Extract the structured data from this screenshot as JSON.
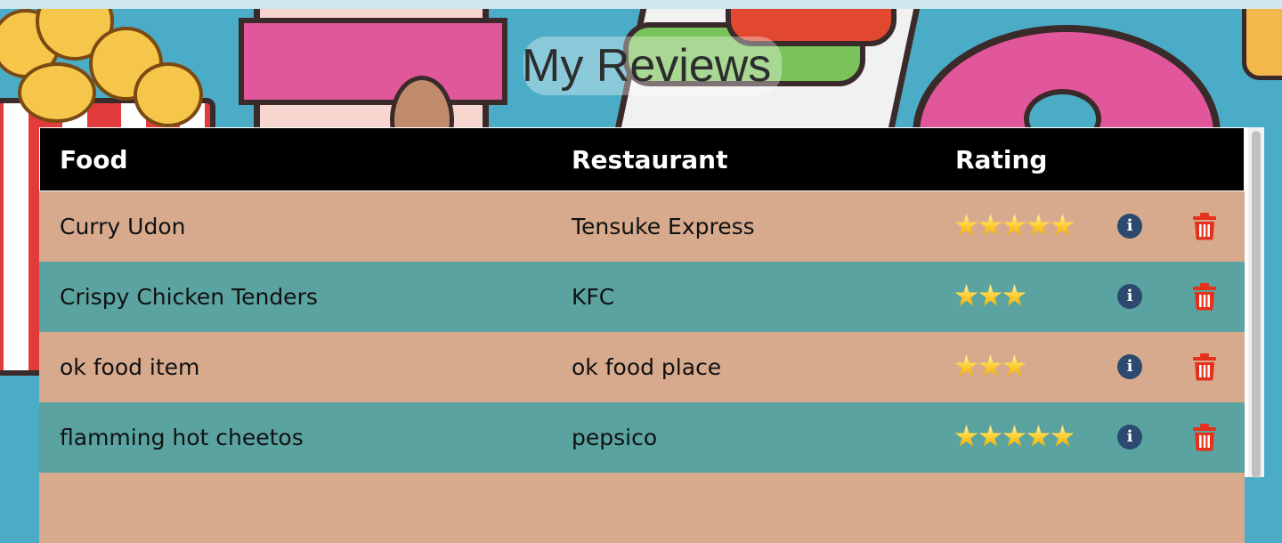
{
  "page": {
    "title": "My Reviews"
  },
  "table": {
    "headers": {
      "food": "Food",
      "restaurant": "Restaurant",
      "rating": "Rating"
    },
    "rows": [
      {
        "food": "Curry Udon",
        "restaurant": "Tensuke Express",
        "rating": 5
      },
      {
        "food": "Crispy Chicken Tenders",
        "restaurant": "KFC",
        "rating": 3
      },
      {
        "food": "ok food item",
        "restaurant": "ok food place",
        "rating": 3
      },
      {
        "food": "flamming hot cheetos",
        "restaurant": "pepsico",
        "rating": 5
      }
    ]
  },
  "icons": {
    "info": "info-circle-icon",
    "delete": "trash-icon",
    "star": "star-icon"
  },
  "colors": {
    "background": "#4aacc6",
    "header_bg": "#000000",
    "row_odd": "#d7aa8e",
    "row_even": "#5aa3a0",
    "info": "#2c4a6f",
    "delete": "#e5311b",
    "star": "#ffd23a"
  }
}
